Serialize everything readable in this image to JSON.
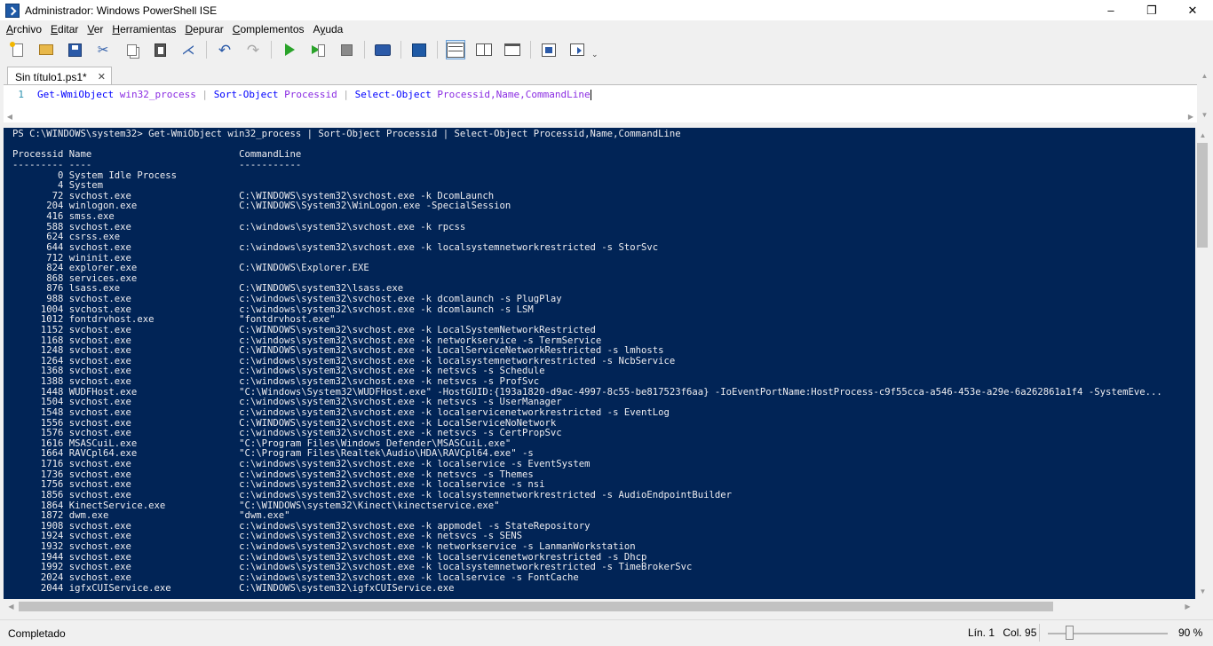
{
  "window": {
    "title": "Administrador: Windows PowerShell ISE",
    "minimize": "–",
    "maximize": "❐",
    "close": "✕"
  },
  "menu": [
    {
      "label": "Archivo",
      "key": "A"
    },
    {
      "label": "Editar",
      "key": "E"
    },
    {
      "label": "Ver",
      "key": "V"
    },
    {
      "label": "Herramientas",
      "key": "H"
    },
    {
      "label": "Depurar",
      "key": "D"
    },
    {
      "label": "Complementos",
      "key": "C"
    },
    {
      "label": "Ayuda",
      "key": "y"
    }
  ],
  "toolbar": {
    "icons": [
      "new-icon",
      "open-icon",
      "save-icon",
      "cut-icon",
      "copy-icon",
      "paste-icon",
      "clear-icon",
      "undo-icon",
      "redo-icon",
      "run-icon",
      "run-selection-icon",
      "stop-icon",
      "remote-icon",
      "powershell-icon",
      "layout-top-icon",
      "layout-right-icon",
      "layout-max-icon",
      "addon-icon",
      "addon-toggle-icon"
    ],
    "overflow": "⌄"
  },
  "tabs": [
    {
      "label": "Sin título1.ps1*",
      "close": "✕"
    }
  ],
  "script": {
    "line_number": "1",
    "tokens": [
      {
        "text": "Get-WmiObject",
        "kind": "cmd"
      },
      {
        "text": " ",
        "kind": "space"
      },
      {
        "text": "win32_process",
        "kind": "arg"
      },
      {
        "text": " | ",
        "kind": "pipe"
      },
      {
        "text": "Sort-Object",
        "kind": "cmd"
      },
      {
        "text": " ",
        "kind": "space"
      },
      {
        "text": "Processid",
        "kind": "arg"
      },
      {
        "text": " | ",
        "kind": "pipe"
      },
      {
        "text": "Select-Object",
        "kind": "cmd"
      },
      {
        "text": " ",
        "kind": "space"
      },
      {
        "text": "Processid,Name,CommandLine",
        "kind": "arg"
      }
    ]
  },
  "console": {
    "prompt_line": "PS C:\\WINDOWS\\system32> Get-WmiObject win32_process | Sort-Object Processid | Select-Object Processid,Name,CommandLine",
    "header": "Processid Name                          CommandLine",
    "separator": "--------- ----                          -----------",
    "rows": [
      [
        "0",
        "System Idle Process",
        ""
      ],
      [
        "4",
        "System",
        ""
      ],
      [
        "72",
        "svchost.exe",
        "C:\\WINDOWS\\system32\\svchost.exe -k DcomLaunch"
      ],
      [
        "204",
        "winlogon.exe",
        "C:\\WINDOWS\\System32\\WinLogon.exe -SpecialSession"
      ],
      [
        "416",
        "smss.exe",
        ""
      ],
      [
        "588",
        "svchost.exe",
        "c:\\windows\\system32\\svchost.exe -k rpcss"
      ],
      [
        "624",
        "csrss.exe",
        ""
      ],
      [
        "644",
        "svchost.exe",
        "c:\\windows\\system32\\svchost.exe -k localsystemnetworkrestricted -s StorSvc"
      ],
      [
        "712",
        "wininit.exe",
        ""
      ],
      [
        "824",
        "explorer.exe",
        "C:\\WINDOWS\\Explorer.EXE"
      ],
      [
        "868",
        "services.exe",
        ""
      ],
      [
        "876",
        "lsass.exe",
        "C:\\WINDOWS\\system32\\lsass.exe"
      ],
      [
        "988",
        "svchost.exe",
        "c:\\windows\\system32\\svchost.exe -k dcomlaunch -s PlugPlay"
      ],
      [
        "1004",
        "svchost.exe",
        "c:\\windows\\system32\\svchost.exe -k dcomlaunch -s LSM"
      ],
      [
        "1012",
        "fontdrvhost.exe",
        "\"fontdrvhost.exe\""
      ],
      [
        "1152",
        "svchost.exe",
        "C:\\WINDOWS\\system32\\svchost.exe -k LocalSystemNetworkRestricted"
      ],
      [
        "1168",
        "svchost.exe",
        "c:\\windows\\system32\\svchost.exe -k networkservice -s TermService"
      ],
      [
        "1248",
        "svchost.exe",
        "C:\\WINDOWS\\system32\\svchost.exe -k LocalServiceNetworkRestricted -s lmhosts"
      ],
      [
        "1264",
        "svchost.exe",
        "c:\\windows\\system32\\svchost.exe -k localsystemnetworkrestricted -s NcbService"
      ],
      [
        "1368",
        "svchost.exe",
        "c:\\windows\\system32\\svchost.exe -k netsvcs -s Schedule"
      ],
      [
        "1388",
        "svchost.exe",
        "c:\\windows\\system32\\svchost.exe -k netsvcs -s ProfSvc"
      ],
      [
        "1448",
        "WUDFHost.exe",
        "\"C:\\Windows\\System32\\WUDFHost.exe\" -HostGUID:{193a1820-d9ac-4997-8c55-be817523f6aa} -IoEventPortName:HostProcess-c9f55cca-a546-453e-a29e-6a262861a1f4 -SystemEve..."
      ],
      [
        "1504",
        "svchost.exe",
        "c:\\windows\\system32\\svchost.exe -k netsvcs -s UserManager"
      ],
      [
        "1548",
        "svchost.exe",
        "c:\\windows\\system32\\svchost.exe -k localservicenetworkrestricted -s EventLog"
      ],
      [
        "1556",
        "svchost.exe",
        "C:\\WINDOWS\\system32\\svchost.exe -k LocalServiceNoNetwork"
      ],
      [
        "1576",
        "svchost.exe",
        "c:\\windows\\system32\\svchost.exe -k netsvcs -s CertPropSvc"
      ],
      [
        "1616",
        "MSASCuiL.exe",
        "\"C:\\Program Files\\Windows Defender\\MSASCuiL.exe\""
      ],
      [
        "1664",
        "RAVCpl64.exe",
        "\"C:\\Program Files\\Realtek\\Audio\\HDA\\RAVCpl64.exe\" -s"
      ],
      [
        "1716",
        "svchost.exe",
        "c:\\windows\\system32\\svchost.exe -k localservice -s EventSystem"
      ],
      [
        "1736",
        "svchost.exe",
        "c:\\windows\\system32\\svchost.exe -k netsvcs -s Themes"
      ],
      [
        "1756",
        "svchost.exe",
        "c:\\windows\\system32\\svchost.exe -k localservice -s nsi"
      ],
      [
        "1856",
        "svchost.exe",
        "c:\\windows\\system32\\svchost.exe -k localsystemnetworkrestricted -s AudioEndpointBuilder"
      ],
      [
        "1864",
        "KinectService.exe",
        "\"C:\\WINDOWS\\system32\\Kinect\\kinectservice.exe\""
      ],
      [
        "1872",
        "dwm.exe",
        "\"dwm.exe\""
      ],
      [
        "1908",
        "svchost.exe",
        "c:\\windows\\system32\\svchost.exe -k appmodel -s StateRepository"
      ],
      [
        "1924",
        "svchost.exe",
        "c:\\windows\\system32\\svchost.exe -k netsvcs -s SENS"
      ],
      [
        "1932",
        "svchost.exe",
        "c:\\windows\\system32\\svchost.exe -k networkservice -s LanmanWorkstation"
      ],
      [
        "1944",
        "svchost.exe",
        "c:\\windows\\system32\\svchost.exe -k localservicenetworkrestricted -s Dhcp"
      ],
      [
        "1992",
        "svchost.exe",
        "c:\\windows\\system32\\svchost.exe -k localsystemnetworkrestricted -s TimeBrokerSvc"
      ],
      [
        "2024",
        "svchost.exe",
        "c:\\windows\\system32\\svchost.exe -k localservice -s FontCache"
      ],
      [
        "2044",
        "igfxCUIService.exe",
        "C:\\WINDOWS\\system32\\igfxCUIService.exe"
      ]
    ]
  },
  "status": {
    "text": "Completado",
    "line": "Lín. 1",
    "column": "Col. 95",
    "zoom": "90 %",
    "zoom_level": 0.18
  },
  "scroll": {
    "up": "▲",
    "down": "▼",
    "left": "◀",
    "right": "▶"
  }
}
